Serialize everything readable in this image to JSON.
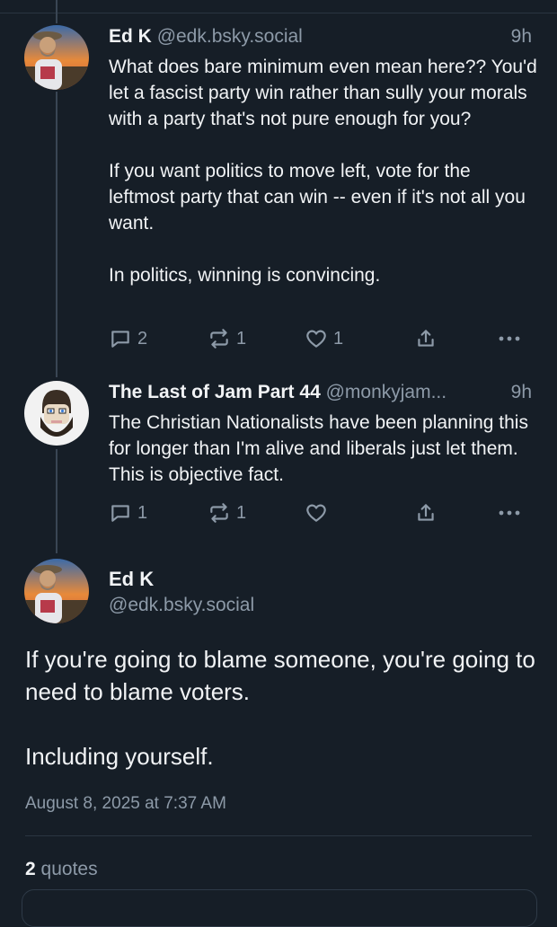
{
  "posts": [
    {
      "name": "Ed K",
      "handle": "@edk.bsky.social",
      "time": "9h",
      "paragraphs": [
        "What does bare minimum even mean here?? You'd let a fascist party win rather than sully your morals with a party that's not pure enough for you?",
        "If you want politics to move left, vote for the leftmost party that can win -- even if it's not all you want.",
        "In politics, winning is convincing."
      ],
      "replies": "2",
      "reposts": "1",
      "likes": "1"
    },
    {
      "name": "The Last of Jam Part 44",
      "handle": "@monkyjam...",
      "time": "9h",
      "paragraphs": [
        "The Christian Nationalists have been planning this for longer than I'm alive and liberals just let them. This is objective fact."
      ],
      "replies": "1",
      "reposts": "1",
      "likes": ""
    }
  ],
  "main_post": {
    "name": "Ed K",
    "handle": "@edk.bsky.social",
    "paragraphs": [
      "If you're going to blame someone, you're going to need to blame voters.",
      "Including yourself."
    ],
    "date": "August 8, 2025 at 7:37 AM",
    "quote_count": "2",
    "quote_label": "quotes"
  },
  "icons": {
    "reply": "reply-icon",
    "repost": "repost-icon",
    "like": "heart-icon",
    "share": "share-icon",
    "more": "more-icon"
  }
}
